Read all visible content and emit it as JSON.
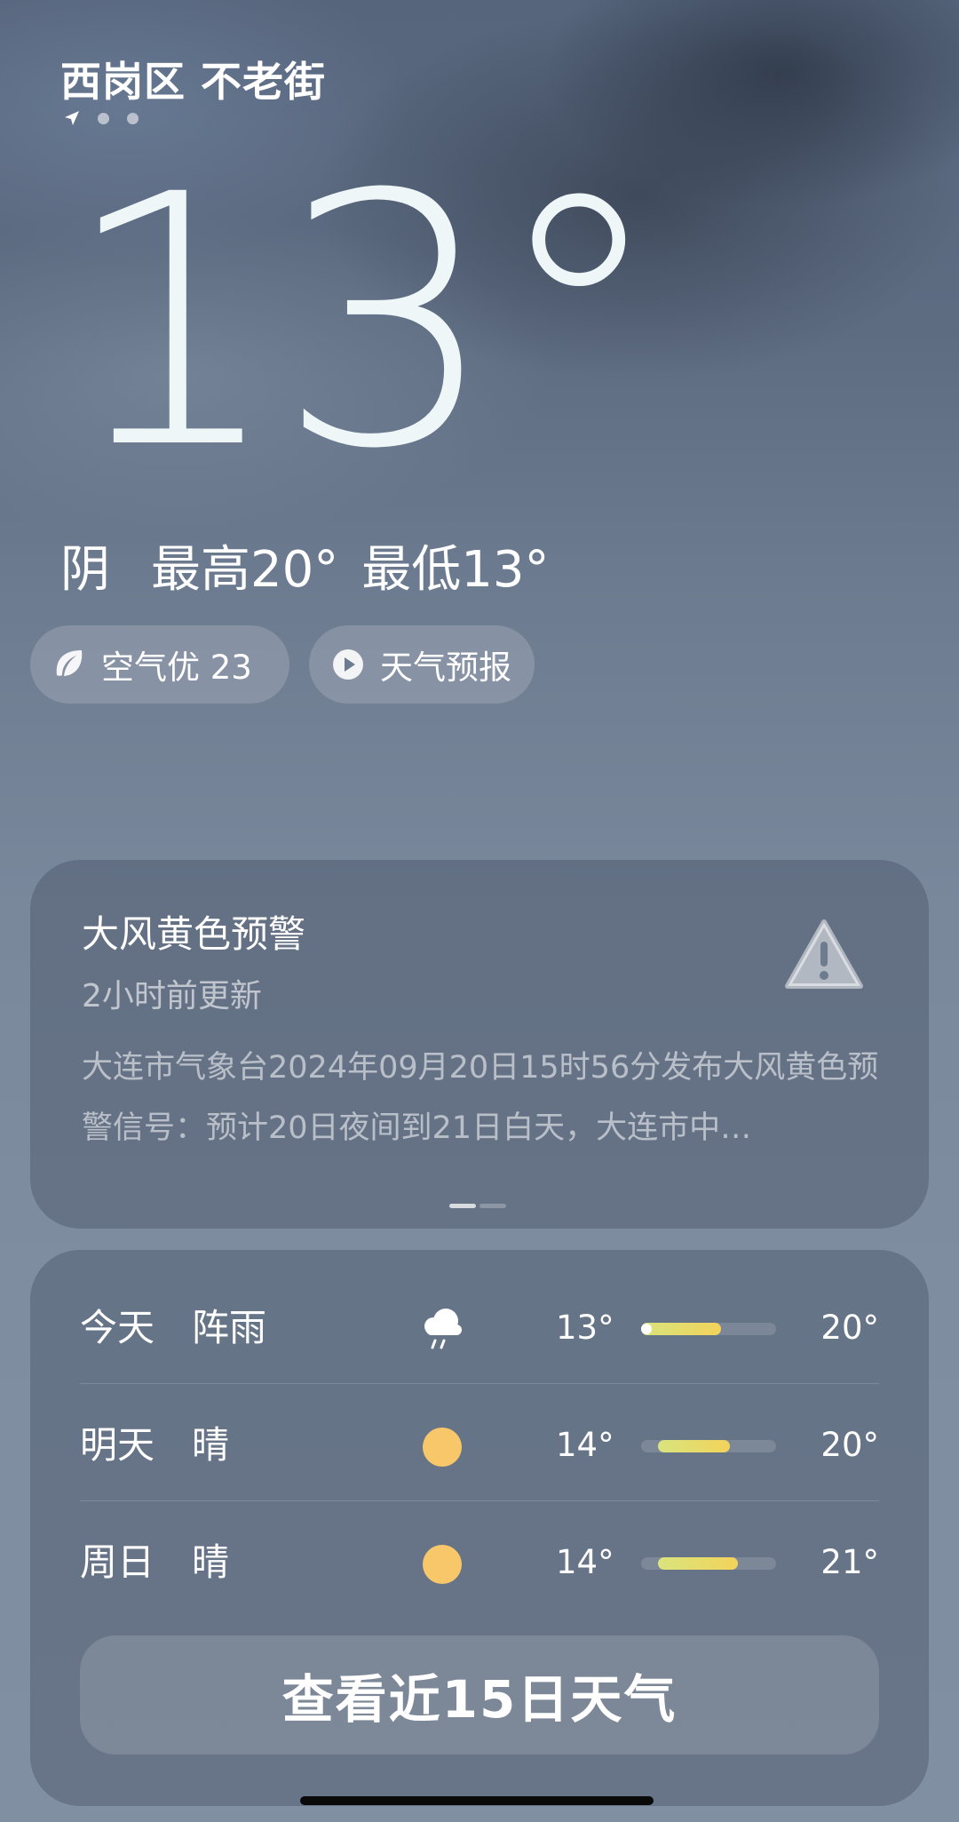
{
  "location": "西岗区 不老街",
  "icons": {
    "location_arrow": "location-arrow-icon",
    "air": "leaf-icon",
    "forecast": "play-icon",
    "alert": "warning-triangle-icon",
    "shower": "cloud-rain-icon",
    "sunny": "sun-icon"
  },
  "current": {
    "temperature": "13°",
    "condition": "阴",
    "high": "最高20°",
    "low": "最低13°"
  },
  "pills": {
    "air_quality": "空气优 23",
    "forecast_video": "天气预报"
  },
  "alert": {
    "title": "大风黄色预警",
    "updated": "2小时前更新",
    "body": "大连市气象台2024年09月20日15时56分发布大风黄色预警信号：预计20日夜间到21日白天，大连市中…"
  },
  "forecast": {
    "temp_range": [
      13,
      21
    ],
    "days": [
      {
        "day": "今天",
        "condition": "阵雨",
        "icon": "cloud-rain-icon",
        "low": "13°",
        "high": "20°",
        "low_value": 13,
        "high_value": 20,
        "current_value": 13
      },
      {
        "day": "明天",
        "condition": "晴",
        "icon": "sun-icon",
        "low": "14°",
        "high": "20°",
        "low_value": 14,
        "high_value": 20
      },
      {
        "day": "周日",
        "condition": "晴",
        "icon": "sun-icon",
        "low": "14°",
        "high": "21°",
        "low_value": 14,
        "high_value": 21
      }
    ],
    "view_15_days": "查看近15日天气"
  },
  "colors": {
    "bar_fill_start": "#d9e47e",
    "bar_fill_end": "#f2d35a",
    "sun": "#f7c76a"
  }
}
